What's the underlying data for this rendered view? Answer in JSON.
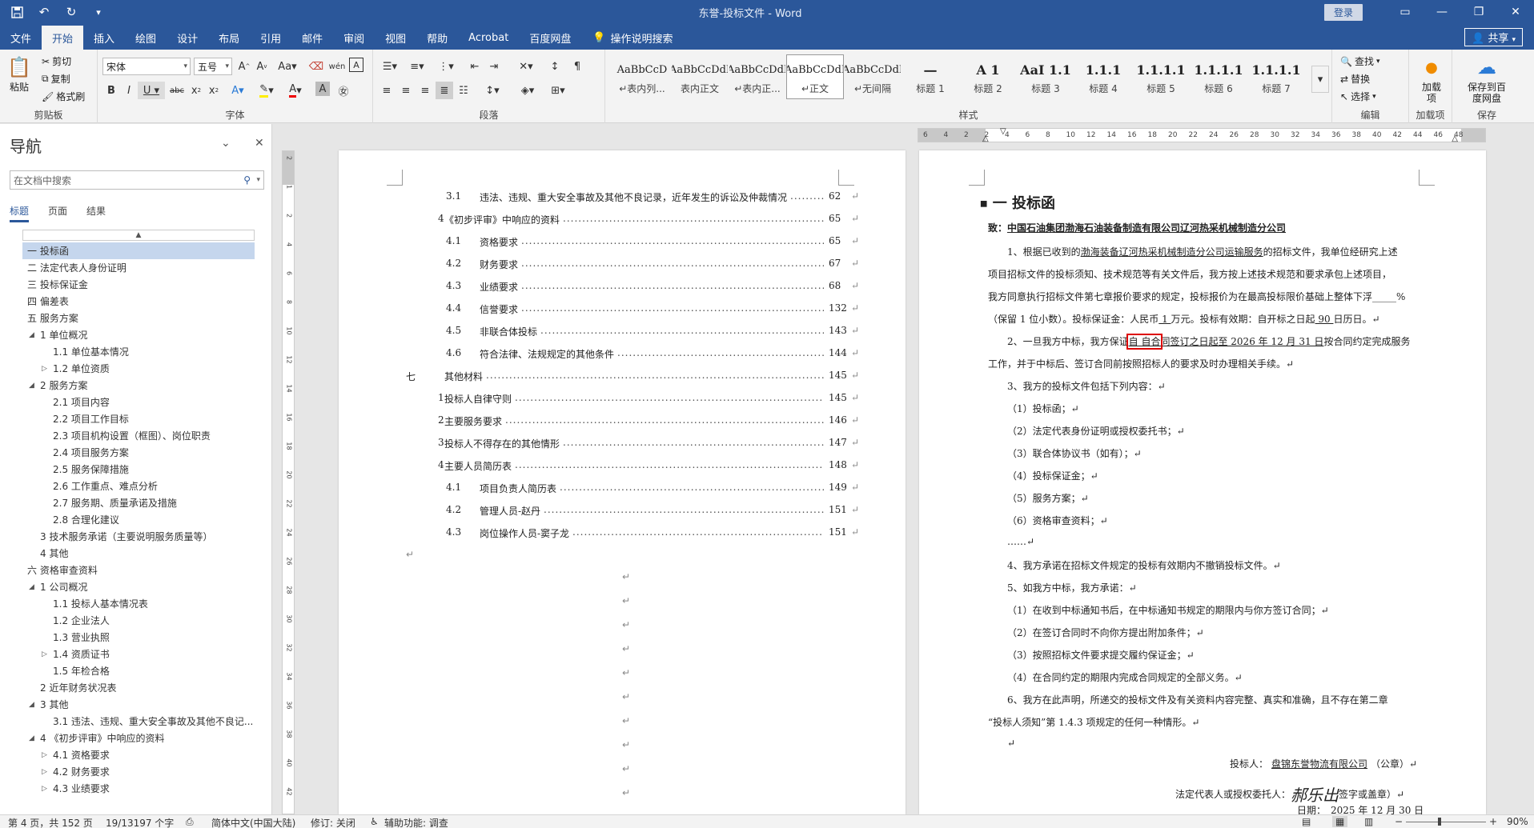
{
  "window": {
    "title": "东誉-投标文件  -  Word",
    "signin": "登录",
    "share": "共享"
  },
  "qat": {
    "save_icon": "save-icon",
    "undo_icon": "undo-icon",
    "redo_icon": "redo-icon",
    "customize_icon": "customize-icon"
  },
  "tabs": [
    "文件",
    "开始",
    "插入",
    "绘图",
    "设计",
    "布局",
    "引用",
    "邮件",
    "审阅",
    "视图",
    "帮助",
    "Acrobat",
    "百度网盘"
  ],
  "tab_search": "操作说明搜索",
  "ribbon": {
    "clipboard": {
      "label": "剪贴板",
      "paste": "粘贴",
      "cut": "剪切",
      "copy": "复制",
      "format_painter": "格式刷"
    },
    "font": {
      "label": "字体",
      "name": "宋体",
      "size": "五号"
    },
    "paragraph": {
      "label": "段落"
    },
    "styles": {
      "label": "样式",
      "items": [
        {
          "sample": "AaBbCcD",
          "name": "↵表内列..."
        },
        {
          "sample": "AaBbCcDdI",
          "name": "表内正文"
        },
        {
          "sample": "AaBbCcDdI",
          "name": "↵表内正..."
        },
        {
          "sample": "AaBbCcDdI",
          "name": "↵正文"
        },
        {
          "sample": "AaBbCcDdI",
          "name": "↵无间隔"
        },
        {
          "sample": "一",
          "name": "标题 1"
        },
        {
          "sample": "A 1",
          "name": "标题 2"
        },
        {
          "sample": "AaI 1.1",
          "name": "标题 3"
        },
        {
          "sample": "1.1.1",
          "name": "标题 4"
        },
        {
          "sample": "1.1.1.1",
          "name": "标题 5"
        },
        {
          "sample": "1.1.1.1",
          "name": "标题 6"
        },
        {
          "sample": "1.1.1.1",
          "name": "标题 7"
        }
      ]
    },
    "editing": {
      "label": "编辑",
      "find": "查找",
      "replace": "替换",
      "select": "选择"
    },
    "addins": {
      "label": "加载项",
      "button": "加载项"
    },
    "save": {
      "label": "保存",
      "button": "保存到百度网盘"
    }
  },
  "nav": {
    "title": "导航",
    "search_placeholder": "在文档中搜索",
    "tabs": [
      "标题",
      "页面",
      "结果"
    ],
    "items": [
      {
        "text": "一 投标函",
        "level": 0,
        "toggle": "",
        "active": true
      },
      {
        "text": "二 法定代表人身份证明",
        "level": 0,
        "toggle": ""
      },
      {
        "text": "三 投标保证金",
        "level": 0,
        "toggle": ""
      },
      {
        "text": "四 偏差表",
        "level": 0,
        "toggle": ""
      },
      {
        "text": "五 服务方案",
        "level": 0,
        "toggle": "◢"
      },
      {
        "text": "1 单位概况",
        "level": 1,
        "toggle": "◢"
      },
      {
        "text": "1.1 单位基本情况",
        "level": 2,
        "toggle": ""
      },
      {
        "text": "1.2 单位资质",
        "level": 2,
        "toggle": "▷"
      },
      {
        "text": "2 服务方案",
        "level": 1,
        "toggle": "◢"
      },
      {
        "text": "2.1 项目内容",
        "level": 2,
        "toggle": ""
      },
      {
        "text": "2.2 项目工作目标",
        "level": 2,
        "toggle": ""
      },
      {
        "text": "2.3 项目机构设置（框图）、岗位职责",
        "level": 2,
        "toggle": ""
      },
      {
        "text": "2.4 项目服务方案",
        "level": 2,
        "toggle": ""
      },
      {
        "text": "2.5 服务保障措施",
        "level": 2,
        "toggle": ""
      },
      {
        "text": "2.6 工作重点、难点分析",
        "level": 2,
        "toggle": ""
      },
      {
        "text": "2.7 服务期、质量承诺及措施",
        "level": 2,
        "toggle": ""
      },
      {
        "text": "2.8 合理化建议",
        "level": 2,
        "toggle": ""
      },
      {
        "text": "3 技术服务承诺（主要说明服务质量等）",
        "level": 1,
        "toggle": ""
      },
      {
        "text": "4 其他",
        "level": 1,
        "toggle": ""
      },
      {
        "text": "六 资格审查资料",
        "level": 0,
        "toggle": "◢"
      },
      {
        "text": "1 公司概况",
        "level": 1,
        "toggle": "◢"
      },
      {
        "text": "1.1 投标人基本情况表",
        "level": 2,
        "toggle": ""
      },
      {
        "text": "1.2 企业法人",
        "level": 2,
        "toggle": ""
      },
      {
        "text": "1.3 营业执照",
        "level": 2,
        "toggle": ""
      },
      {
        "text": "1.4 资质证书",
        "level": 2,
        "toggle": "▷"
      },
      {
        "text": "1.5 年检合格",
        "level": 2,
        "toggle": ""
      },
      {
        "text": "2 近年财务状况表",
        "level": 1,
        "toggle": ""
      },
      {
        "text": "3 其他",
        "level": 1,
        "toggle": "◢"
      },
      {
        "text": "3.1 违法、违规、重大安全事故及其他不良记...",
        "level": 2,
        "toggle": ""
      },
      {
        "text": "4 《初步评审》中响应的资料",
        "level": 1,
        "toggle": "◢"
      },
      {
        "text": "4.1 资格要求",
        "level": 2,
        "toggle": "▷"
      },
      {
        "text": "4.2 财务要求",
        "level": 2,
        "toggle": "▷"
      },
      {
        "text": "4.3 业绩要求",
        "level": 2,
        "toggle": "▷"
      }
    ]
  },
  "vruler_labels": [
    "2",
    "1",
    "2",
    "4",
    "6",
    "8",
    "10",
    "12",
    "14",
    "16",
    "18",
    "20",
    "22",
    "24",
    "26",
    "28",
    "30",
    "32",
    "34",
    "36",
    "38",
    "40",
    "42"
  ],
  "hruler_labels": [
    "6",
    "4",
    "2",
    "2",
    "4",
    "6",
    "8",
    "10",
    "12",
    "14",
    "16",
    "18",
    "20",
    "22",
    "24",
    "26",
    "28",
    "30",
    "32",
    "34",
    "36",
    "38",
    "40",
    "42",
    "44",
    "46",
    "48"
  ],
  "toc": [
    {
      "num": "3.1",
      "text": "违法、违规、重大安全事故及其他不良记录，近年发生的诉讼及仲裁情况",
      "page": "62",
      "indent": 2
    },
    {
      "num": "4",
      "text": "《初步评审》中响应的资料",
      "page": "65",
      "indent": 1
    },
    {
      "num": "4.1",
      "text": "资格要求",
      "page": "65",
      "indent": 2
    },
    {
      "num": "4.2",
      "text": "财务要求",
      "page": "67",
      "indent": 2
    },
    {
      "num": "4.3",
      "text": "业绩要求",
      "page": "68",
      "indent": 2
    },
    {
      "num": "4.4",
      "text": "信誉要求",
      "page": "132",
      "indent": 2
    },
    {
      "num": "4.5",
      "text": "非联合体投标",
      "page": "143",
      "indent": 2
    },
    {
      "num": "4.6",
      "text": "符合法律、法规规定的其他条件",
      "page": "144",
      "indent": 2
    },
    {
      "num": "七",
      "text": "其他材料",
      "page": "145",
      "indent": 0
    },
    {
      "num": "1",
      "text": "投标人自律守则",
      "page": "145",
      "indent": 1
    },
    {
      "num": "2",
      "text": "主要服务要求",
      "page": "146",
      "indent": 1
    },
    {
      "num": "3",
      "text": "投标人不得存在的其他情形",
      "page": "147",
      "indent": 1
    },
    {
      "num": "4",
      "text": "主要人员简历表",
      "page": "148",
      "indent": 1
    },
    {
      "num": "4.1",
      "text": "项目负责人简历表",
      "page": "149",
      "indent": 2
    },
    {
      "num": "4.2",
      "text": "管理人员-赵丹",
      "page": "151",
      "indent": 2
    },
    {
      "num": "4.3",
      "text": "岗位操作人员-窦子龙",
      "page": "151",
      "indent": 2
    }
  ],
  "letter": {
    "heading": "一 投标函",
    "to_prefix": "致：",
    "to_company": "中国石油集团渤海石油装备制造有限公司辽河热采机械制造分公司",
    "lines": [
      {
        "parts": [
          {
            "t": "1、根据已收到的",
            "u": false
          },
          {
            "t": "渤海装备辽河热采机械制造分公司运输服务",
            "u": true
          },
          {
            "t": "的招标文件，我单位经研究上述",
            "u": false
          }
        ],
        "indent": true
      },
      {
        "parts": [
          {
            "t": "项目招标文件的投标须知、技术规范等有关文件后，我方按上述技术规范和要求承包上述项目，",
            "u": false
          }
        ],
        "indent": false
      },
      {
        "parts": [
          {
            "t": "我方同意执行招标文件第七章报价要求的规定，投标报价为在最高投标限价基础上整体下浮",
            "u": false
          },
          {
            "t": "_____",
            "u": false
          },
          {
            "t": "%",
            "u": false
          }
        ],
        "indent": false
      },
      {
        "parts": [
          {
            "t": "（保留 1 位小数）。投标保证金：人民币",
            "u": false
          },
          {
            "t": " 1 ",
            "u": true
          },
          {
            "t": "万元。投标有效期：自开标之日起",
            "u": false
          },
          {
            "t": " 90 ",
            "u": true
          },
          {
            "t": "日历日。↵",
            "u": false
          }
        ],
        "indent": false
      },
      {
        "parts": [
          {
            "t": "2、一旦我方中标，我方保证",
            "u": false
          },
          {
            "t": "自  自合",
            "u": true,
            "box": true
          },
          {
            "t": "同签订之日起至 2026 年 12 月 31 日",
            "u": true
          },
          {
            "t": "按合同约定完成服务",
            "u": false
          }
        ],
        "indent": true
      },
      {
        "parts": [
          {
            "t": "工作，并于中标后、签订合同前按照招标人的要求及时办理相关手续。↵",
            "u": false
          }
        ],
        "indent": false
      },
      {
        "parts": [
          {
            "t": "3、我方的投标文件包括下列内容：↵",
            "u": false
          }
        ],
        "indent": true
      },
      {
        "parts": [
          {
            "t": "（1）投标函；↵",
            "u": false
          }
        ],
        "indent": true
      },
      {
        "parts": [
          {
            "t": "（2）法定代表身份证明或授权委托书；↵",
            "u": false
          }
        ],
        "indent": true
      },
      {
        "parts": [
          {
            "t": "（3）联合体协议书（如有）；↵",
            "u": false
          }
        ],
        "indent": true
      },
      {
        "parts": [
          {
            "t": "（4）投标保证金；↵",
            "u": false
          }
        ],
        "indent": true
      },
      {
        "parts": [
          {
            "t": "（5）服务方案；↵",
            "u": false
          }
        ],
        "indent": true
      },
      {
        "parts": [
          {
            "t": "（6）资格审查资料；↵",
            "u": false
          }
        ],
        "indent": true
      },
      {
        "parts": [
          {
            "t": "……↵",
            "u": false
          }
        ],
        "indent": true
      },
      {
        "parts": [
          {
            "t": "4、我方承诺在招标文件规定的投标有效期内不撤销投标文件。↵",
            "u": false
          }
        ],
        "indent": true
      },
      {
        "parts": [
          {
            "t": "5、如我方中标，我方承诺：↵",
            "u": false
          }
        ],
        "indent": true
      },
      {
        "parts": [
          {
            "t": "（1）在收到中标通知书后，在中标通知书规定的期限内与你方签订合同；↵",
            "u": false
          }
        ],
        "indent": true
      },
      {
        "parts": [
          {
            "t": "（2）在签订合同时不向你方提出附加条件；↵",
            "u": false
          }
        ],
        "indent": true
      },
      {
        "parts": [
          {
            "t": "（3）按照招标文件要求提交履约保证金；↵",
            "u": false
          }
        ],
        "indent": true
      },
      {
        "parts": [
          {
            "t": "（4）在合同约定的期限内完成合同规定的全部义务。↵",
            "u": false
          }
        ],
        "indent": true
      },
      {
        "parts": [
          {
            "t": "6、我方在此声明，所递交的投标文件及有关资料内容完整、真实和准确，且不存在第二章",
            "u": false
          }
        ],
        "indent": true
      },
      {
        "parts": [
          {
            "t": "“投标人须知”第 1.4.3 项规定的任何一种情形。↵",
            "u": false
          }
        ],
        "indent": false
      },
      {
        "parts": [
          {
            "t": "↵",
            "u": false
          }
        ],
        "indent": true
      }
    ],
    "bidder_label": "投标人：",
    "bidder_name": "盘锦东誉物流有限公司",
    "bidder_suffix": "（公章）↵",
    "rep_label": "法定代表人或授权委托人：",
    "rep_signature": "郝乐出",
    "rep_suffix": "签字或盖章）↵",
    "date_label": "日期：",
    "date_value": "2025 年 12 月 30 日"
  },
  "status": {
    "page": "第 4 页，共 152 页",
    "words": "19/13197 个字",
    "lang": "简体中文(中国大陆)",
    "track": "修订: 关闭",
    "access": "辅助功能: 调查",
    "zoom": "90%"
  }
}
